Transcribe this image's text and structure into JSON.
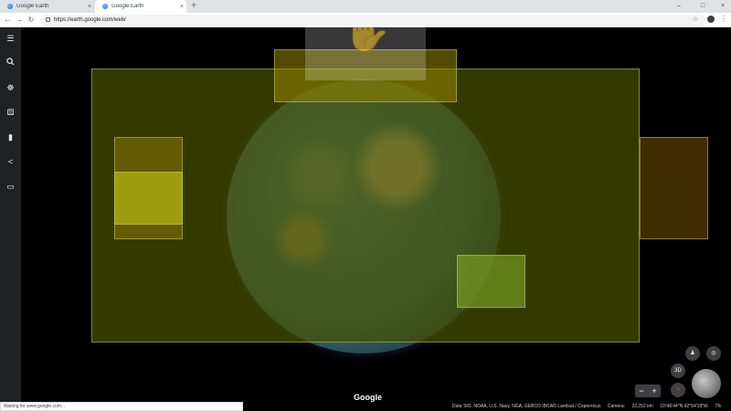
{
  "tabs": [
    {
      "title": "Google Earth",
      "close": "×"
    },
    {
      "title": "Google Earth",
      "close": "×"
    }
  ],
  "new_tab": "+",
  "window_controls": {
    "minimize": "–",
    "maximize": "□",
    "close": "×"
  },
  "address_bar": {
    "url": "https://earth.google.com/web/"
  },
  "rail": {
    "items": [
      "menu-icon",
      "search-icon",
      "voyager-icon",
      "feeling-lucky-icon",
      "projects-icon",
      "share-icon",
      "measure-icon"
    ]
  },
  "map": {
    "google_logo": "Google",
    "attribution": "Data SIO, NOAA, U.S. Navy, NGA, GEBCO IBCAO Landsat / Copernicus",
    "camera_label": "Camera:",
    "camera_value": "22,252 km",
    "coordinates": "10°46'44\"N 42°54'18\"W",
    "percent": "7%",
    "controls": {
      "three_d": "3D",
      "zoom_in": "+",
      "zoom_out": "−",
      "compass": "N"
    }
  },
  "status_bar": "Waiting for www.google.com...",
  "colors": {
    "accent": "#1a73e8",
    "rail_bg": "#202124",
    "overlay_yellow": "#8a8c00"
  }
}
